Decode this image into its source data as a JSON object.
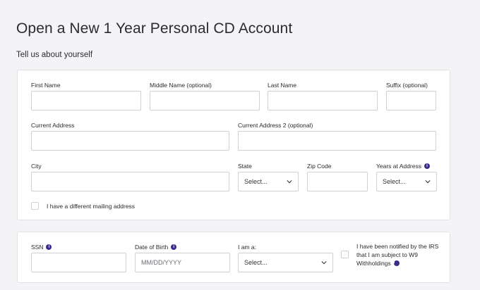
{
  "page": {
    "title": "Open a New 1 Year Personal CD Account",
    "subtitle": "Tell us about yourself"
  },
  "personal_info": {
    "first_name": {
      "label": "First Name",
      "value": ""
    },
    "middle_name": {
      "label": "Middle Name (optional)",
      "value": ""
    },
    "last_name": {
      "label": "Last Name",
      "value": ""
    },
    "suffix": {
      "label": "Suffix (optional)",
      "value": ""
    },
    "current_address": {
      "label": "Current Address",
      "value": ""
    },
    "current_address_2": {
      "label": "Current Address 2 (optional)",
      "value": ""
    },
    "city": {
      "label": "City",
      "value": ""
    },
    "state": {
      "label": "State",
      "selected": "Select..."
    },
    "zip_code": {
      "label": "Zip Code",
      "value": ""
    },
    "years_at_address": {
      "label": "Years at Address",
      "selected": "Select...",
      "icon": "info-icon"
    },
    "mailing_address_checkbox": {
      "label": "I have a different mailing address",
      "checked": false
    }
  },
  "identity": {
    "ssn": {
      "label": "SSN",
      "value": "",
      "icon": "info-icon"
    },
    "dob": {
      "label": "Date of Birth",
      "placeholder": "MM/DD/YYYY",
      "icon": "info-icon"
    },
    "i_am_a": {
      "label": "I am a:",
      "selected": "Select..."
    },
    "irs_checkbox": {
      "line1": "I have been notified by the IRS",
      "line2": "that I am subject to W9",
      "line3": "Withholdings",
      "checked": false,
      "icon": "info-icon"
    }
  },
  "colors": {
    "background": "#f4f4f6",
    "card": "#ffffff",
    "border": "#cfcfd4",
    "info_icon": "#3b2a8c"
  }
}
